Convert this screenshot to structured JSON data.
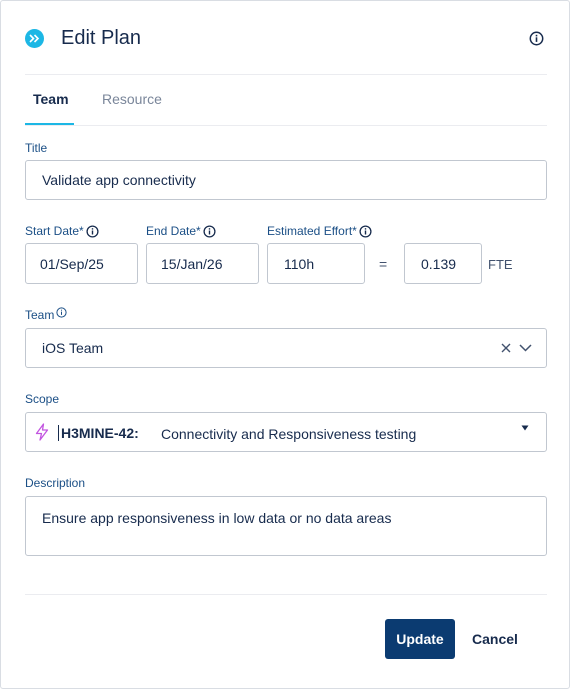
{
  "dialog": {
    "title": "Edit Plan"
  },
  "tabs": [
    {
      "label": "Team",
      "active": true
    },
    {
      "label": "Resource",
      "active": false
    }
  ],
  "form": {
    "title_label": "Title",
    "title_value": "Validate app connectivity",
    "start_date_label": "Start Date*",
    "start_date_value": "01/Sep/25",
    "end_date_label": "End Date*",
    "end_date_value": "15/Jan/26",
    "effort_label": "Estimated Effort*",
    "effort_value": "110h",
    "equals": "=",
    "fte_value": "0.139",
    "fte_unit": "FTE",
    "team_label": "Team",
    "team_value": "iOS Team",
    "scope_label": "Scope",
    "scope_key": "H3MINE-42:",
    "scope_summary": "Connectivity and Responsiveness testing",
    "description_label": "Description",
    "description_value": "Ensure app responsiveness in low data or no data areas"
  },
  "actions": {
    "update_label": "Update",
    "cancel_label": "Cancel"
  },
  "colors": {
    "accent": "#1cb7e5",
    "primary_button": "#0b3b71",
    "label_text": "#1b4f86",
    "scope_icon": "#c255e0"
  }
}
